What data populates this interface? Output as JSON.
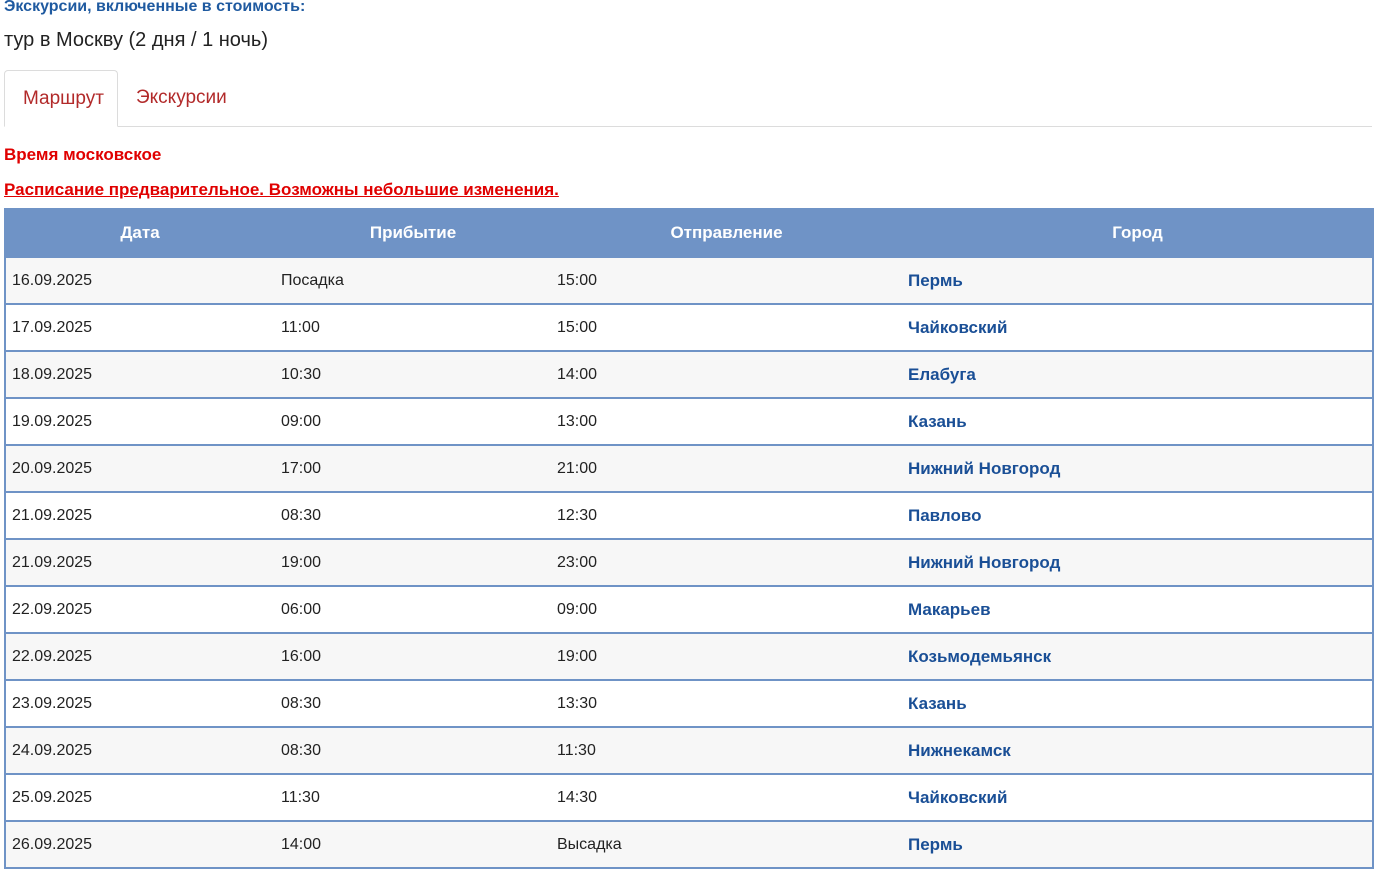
{
  "header": {
    "excursions_label": "Экскурсии, включенные в стоимость:",
    "tour_name": "тур в Москву (2 дня / 1 ночь)"
  },
  "tabs": [
    {
      "label": "Маршрут",
      "active": true
    },
    {
      "label": "Экскурсии",
      "active": false
    }
  ],
  "notices": {
    "time": "Время московское",
    "schedule": "Расписание предварительное. Возможны небольшие изменения."
  },
  "table": {
    "columns": [
      "Дата",
      "Прибытие",
      "Отправление",
      "Город"
    ],
    "rows": [
      {
        "date": "16.09.2025",
        "arrival": "Посадка",
        "departure": "15:00",
        "city": "Пермь"
      },
      {
        "date": "17.09.2025",
        "arrival": "11:00",
        "departure": "15:00",
        "city": "Чайковский"
      },
      {
        "date": "18.09.2025",
        "arrival": "10:30",
        "departure": "14:00",
        "city": "Елабуга"
      },
      {
        "date": "19.09.2025",
        "arrival": "09:00",
        "departure": "13:00",
        "city": "Казань"
      },
      {
        "date": "20.09.2025",
        "arrival": "17:00",
        "departure": "21:00",
        "city": "Нижний Новгород"
      },
      {
        "date": "21.09.2025",
        "arrival": "08:30",
        "departure": "12:30",
        "city": "Павлово"
      },
      {
        "date": "21.09.2025",
        "arrival": "19:00",
        "departure": "23:00",
        "city": "Нижний Новгород"
      },
      {
        "date": "22.09.2025",
        "arrival": "06:00",
        "departure": "09:00",
        "city": "Макарьев"
      },
      {
        "date": "22.09.2025",
        "arrival": "16:00",
        "departure": "19:00",
        "city": "Козьмодемьянск"
      },
      {
        "date": "23.09.2025",
        "arrival": "08:30",
        "departure": "13:30",
        "city": "Казань"
      },
      {
        "date": "24.09.2025",
        "arrival": "08:30",
        "departure": "11:30",
        "city": "Нижнекамск"
      },
      {
        "date": "25.09.2025",
        "arrival": "11:30",
        "departure": "14:30",
        "city": "Чайковский"
      },
      {
        "date": "26.09.2025",
        "arrival": "14:00",
        "departure": "Высадка",
        "city": "Пермь"
      }
    ]
  },
  "colors": {
    "header_bg": "#6f93c6",
    "accent_red": "#e00000",
    "tab_text": "#b22a2a",
    "city_link": "#1a4f96",
    "heading_blue": "#1f5aa0"
  }
}
